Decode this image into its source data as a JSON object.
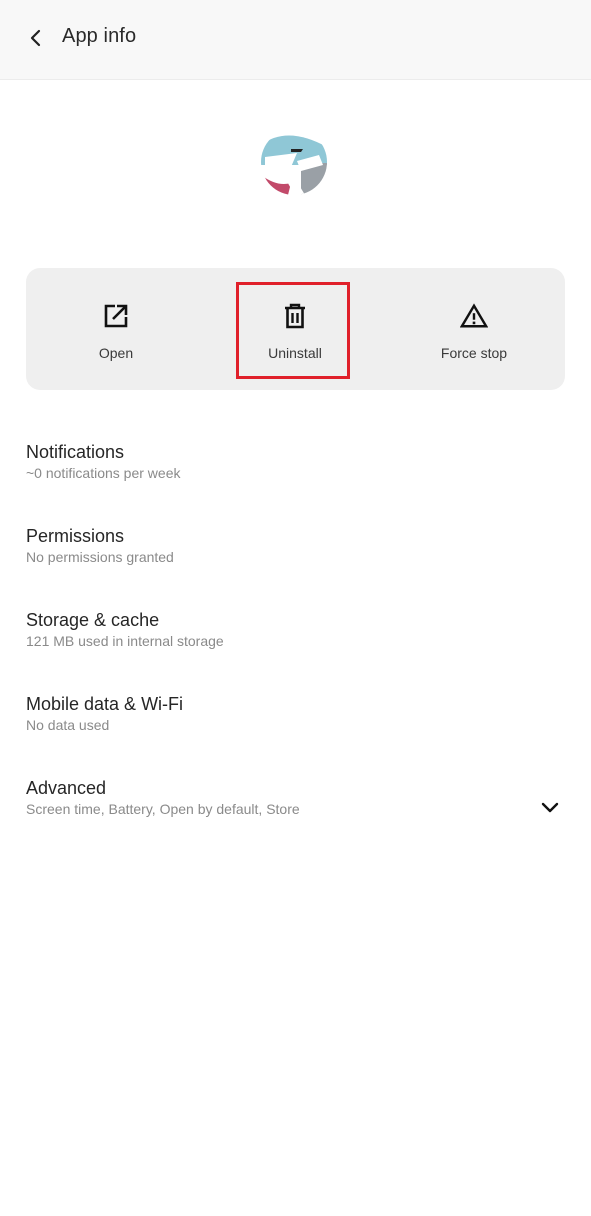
{
  "app_bar": {
    "back_icon": "chevron-left-icon",
    "title": "App info"
  },
  "app_icon": {
    "icon": "app-icon",
    "colors": [
      "#8fc7d6",
      "#c24a6a",
      "#9aa0a6"
    ]
  },
  "actions": [
    {
      "id": "open",
      "label": "Open",
      "icon": "open-external-icon"
    },
    {
      "id": "uninstall",
      "label": "Uninstall",
      "icon": "trash-icon",
      "highlighted": true
    },
    {
      "id": "force_stop",
      "label": "Force stop",
      "icon": "warning-triangle-icon"
    }
  ],
  "highlight_color": "#e0202a",
  "settings": [
    {
      "title": "Notifications",
      "subtitle": "~0 notifications per week"
    },
    {
      "title": "Permissions",
      "subtitle": "No permissions granted"
    },
    {
      "title": "Storage & cache",
      "subtitle": "121 MB used in internal storage"
    },
    {
      "title": "Mobile data & Wi-Fi",
      "subtitle": "No data used"
    },
    {
      "title": "Advanced",
      "subtitle": "Screen time, Battery, Open by default, Store",
      "expand_icon": "chevron-down-icon"
    }
  ]
}
